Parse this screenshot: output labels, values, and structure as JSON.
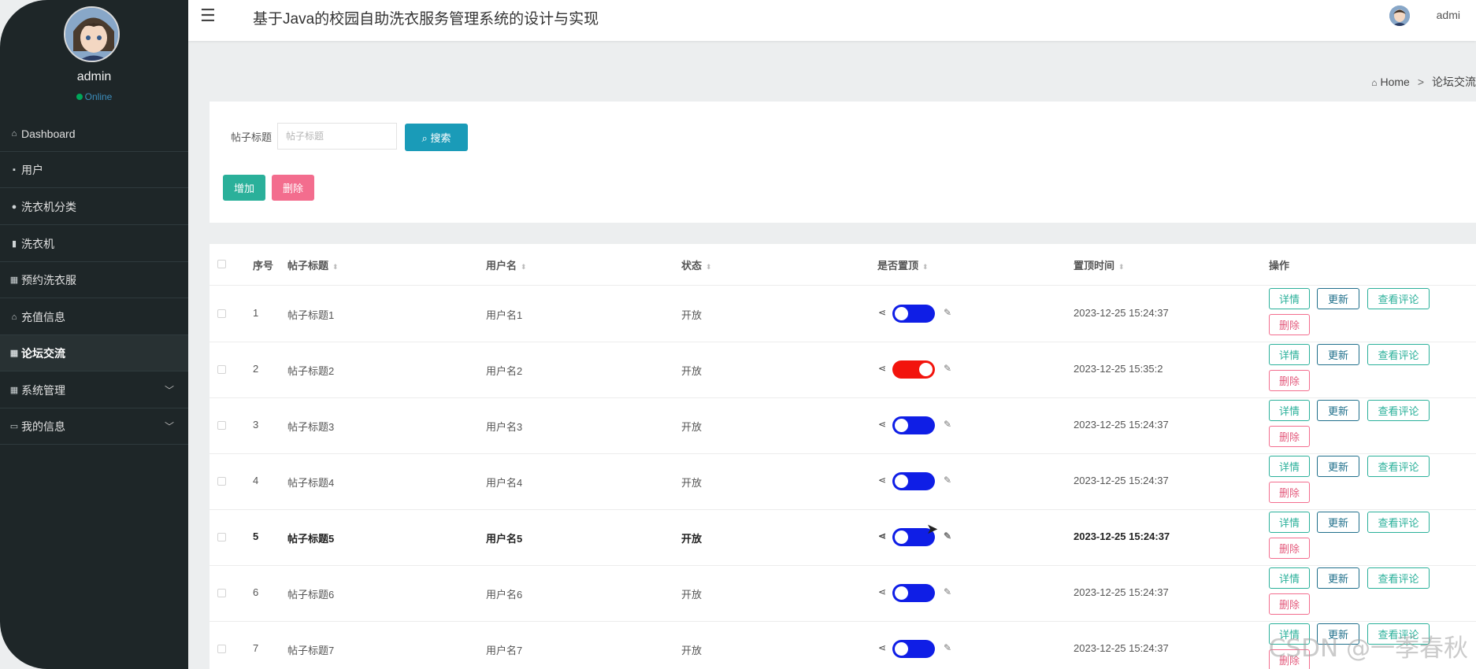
{
  "sidebar": {
    "username": "admin",
    "status": "Online",
    "items": [
      {
        "label": "Dashboard",
        "icon": "home-icon"
      },
      {
        "label": "用户",
        "icon": "user-icon"
      },
      {
        "label": "洗衣机分类",
        "icon": "location-icon"
      },
      {
        "label": "洗衣机",
        "icon": "chart-icon"
      },
      {
        "label": "预约洗衣服",
        "icon": "grid-icon"
      },
      {
        "label": "充值信息",
        "icon": "bank-icon"
      },
      {
        "label": "论坛交流",
        "icon": "grid-icon"
      },
      {
        "label": "系统管理",
        "icon": "grid-icon"
      },
      {
        "label": "我的信息",
        "icon": "card-icon"
      }
    ]
  },
  "header": {
    "title": "基于Java的校园自助洗衣服务管理系统的设计与实现",
    "user": "admi"
  },
  "breadcrumb": {
    "home": "Home",
    "separator": ">",
    "current": "论坛交流"
  },
  "search": {
    "label": "帖子标题",
    "placeholder": "帖子标题",
    "button": "搜索"
  },
  "actions": {
    "add": "增加",
    "delete": "删除"
  },
  "table": {
    "headers": [
      "序号",
      "帖子标题",
      "用户名",
      "状态",
      "是否置顶",
      "置顶时间",
      "操作"
    ],
    "buttons": {
      "detail": "详情",
      "update": "更新",
      "comments": "查看评论",
      "delete": "删除"
    },
    "rows": [
      {
        "no": "1",
        "title": "帖子标题1",
        "user": "用户名1",
        "status": "开放",
        "pinned": false,
        "time": "2023-12-25 15:24:37"
      },
      {
        "no": "2",
        "title": "帖子标题2",
        "user": "用户名2",
        "status": "开放",
        "pinned": true,
        "time": "2023-12-25 15:35:2"
      },
      {
        "no": "3",
        "title": "帖子标题3",
        "user": "用户名3",
        "status": "开放",
        "pinned": false,
        "time": "2023-12-25 15:24:37"
      },
      {
        "no": "4",
        "title": "帖子标题4",
        "user": "用户名4",
        "status": "开放",
        "pinned": false,
        "time": "2023-12-25 15:24:37"
      },
      {
        "no": "5",
        "title": "帖子标题5",
        "user": "用户名5",
        "status": "开放",
        "pinned": false,
        "time": "2023-12-25 15:24:37"
      },
      {
        "no": "6",
        "title": "帖子标题6",
        "user": "用户名6",
        "status": "开放",
        "pinned": false,
        "time": "2023-12-25 15:24:37"
      },
      {
        "no": "7",
        "title": "帖子标题7",
        "user": "用户名7",
        "status": "开放",
        "pinned": false,
        "time": "2023-12-25 15:24:37"
      }
    ]
  },
  "watermark": "CSDN @一季春秋"
}
